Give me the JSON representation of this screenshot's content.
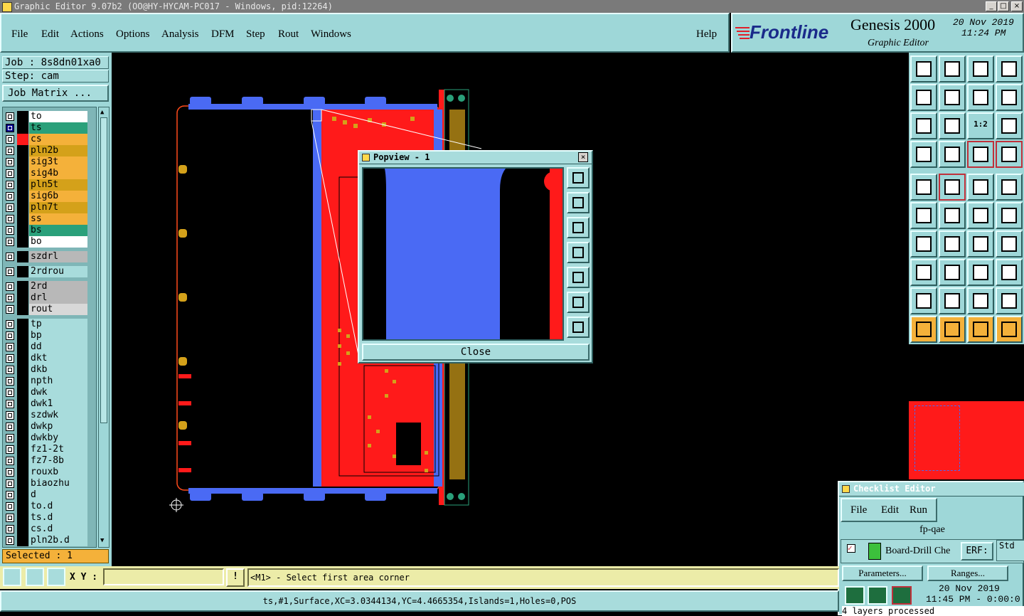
{
  "window": {
    "title": "Graphic Editor 9.07b2 (OO@HY-HYCAM-PC017 - Windows, pid:12264)",
    "controls": [
      "_",
      "□",
      "×"
    ]
  },
  "menu": {
    "items": [
      "File",
      "Edit",
      "Actions",
      "Options",
      "Analysis",
      "DFM",
      "Step",
      "Rout",
      "Windows"
    ],
    "help": "Help"
  },
  "brand": {
    "logo": "Frontline",
    "product": "Genesis 2000",
    "subtitle": "Graphic Editor",
    "date": "20 Nov 2019",
    "time": "11:24 PM"
  },
  "job": {
    "job_label": "Job : 8s8dn01xa0",
    "step_label": "Step: cam",
    "matrix_button": "Job Matrix ..."
  },
  "layers": {
    "group1": [
      {
        "name": "to",
        "color": "#ffffff",
        "checked": false,
        "swatch": "#000000"
      },
      {
        "name": "ts",
        "color": "#2aa07a",
        "checked": true,
        "swatch": "#000000"
      },
      {
        "name": "cs",
        "color": "#f4b13a",
        "checked": false,
        "swatch": "#ff1a1a"
      },
      {
        "name": "pln2b",
        "color": "#d4a11a",
        "checked": false,
        "swatch": "#000000"
      },
      {
        "name": "sig3t",
        "color": "#f4b13a",
        "checked": false,
        "swatch": "#000000"
      },
      {
        "name": "sig4b",
        "color": "#f4b13a",
        "checked": false,
        "swatch": "#000000"
      },
      {
        "name": "pln5t",
        "color": "#d4a11a",
        "checked": false,
        "swatch": "#000000"
      },
      {
        "name": "sig6b",
        "color": "#f4b13a",
        "checked": false,
        "swatch": "#000000"
      },
      {
        "name": "pln7t",
        "color": "#d4a11a",
        "checked": false,
        "swatch": "#000000"
      },
      {
        "name": "ss",
        "color": "#f4b13a",
        "checked": false,
        "swatch": "#000000"
      },
      {
        "name": "bs",
        "color": "#2aa07a",
        "checked": false,
        "swatch": "#000000"
      },
      {
        "name": "bo",
        "color": "#ffffff",
        "checked": false,
        "swatch": "#000000"
      }
    ],
    "group2": [
      {
        "name": "szdrl",
        "color": "#b8b8b8"
      }
    ],
    "group3": [
      {
        "name": "2rdrou",
        "color": "#a8dcdc"
      }
    ],
    "group4": [
      {
        "name": "2rd",
        "color": "#b8b8b8"
      },
      {
        "name": "drl",
        "color": "#b8b8b8"
      },
      {
        "name": "rout",
        "color": "#d8d8d8"
      }
    ],
    "group5": [
      {
        "name": "tp"
      },
      {
        "name": "bp"
      },
      {
        "name": "dd"
      },
      {
        "name": "dkt"
      },
      {
        "name": "dkb"
      },
      {
        "name": "npth"
      },
      {
        "name": "dwk"
      },
      {
        "name": "dwk1"
      },
      {
        "name": "szdwk"
      },
      {
        "name": "dwkp"
      },
      {
        "name": "dwkby"
      },
      {
        "name": "fz1-2t"
      },
      {
        "name": "fz7-8b"
      },
      {
        "name": "rouxb"
      },
      {
        "name": "biaozhu"
      },
      {
        "name": "d"
      },
      {
        "name": "to.d"
      },
      {
        "name": "ts.d"
      },
      {
        "name": "cs.d"
      },
      {
        "name": "pln2b.d"
      }
    ],
    "selected_label": "Selected : 1"
  },
  "status": {
    "xy_label": "X Y :",
    "xy_value": "",
    "prompt": "<M1> - Select first area corner",
    "info": "ts,#1,Surface,XC=3.0344134,YC=4.4665354,Islands=1,Holes=0,POS"
  },
  "popview": {
    "title": "Popview - 1",
    "close": "Close"
  },
  "toolbar": {
    "tools": [
      "zoom-home",
      "zoom-in",
      "home",
      "zoom-layout",
      "pan-left",
      "pan-right",
      "mirror",
      "flip",
      "fit-screen",
      "center",
      "scale-1-2",
      "help",
      "snap",
      "grid",
      "drill-check",
      "drill-config",
      "select-feature",
      "color-map",
      "ruler",
      "circle-pad",
      "connect",
      "cross",
      "add-pad",
      "move-pad",
      "arc-line",
      "line",
      "rotate",
      "text-tool",
      "net",
      "line-break",
      "measure",
      "component",
      "triangle-cut",
      "triangle-tool",
      "triangle-tool-2",
      "triangle-tool-3",
      "pointer",
      "select-box",
      "select-outline",
      "route"
    ],
    "scale_label": "1:2"
  },
  "checklist": {
    "title": "Checklist Editor",
    "menu": [
      "File",
      "Edit",
      "Run"
    ],
    "name": "fp-qae",
    "item": "Board-Drill Che",
    "erf": "ERF:",
    "std": "Std",
    "parameters": "Parameters...",
    "ranges": "Ranges...",
    "date": "20 Nov 2019",
    "time": "11:45 PM - 0:00:0",
    "log": "4 layers processed"
  },
  "colors": {
    "teal": "#9ed7d8",
    "board_red": "#ff1a1a",
    "board_blue": "#4a6af4",
    "highlight_orange": "#f4b13a"
  }
}
